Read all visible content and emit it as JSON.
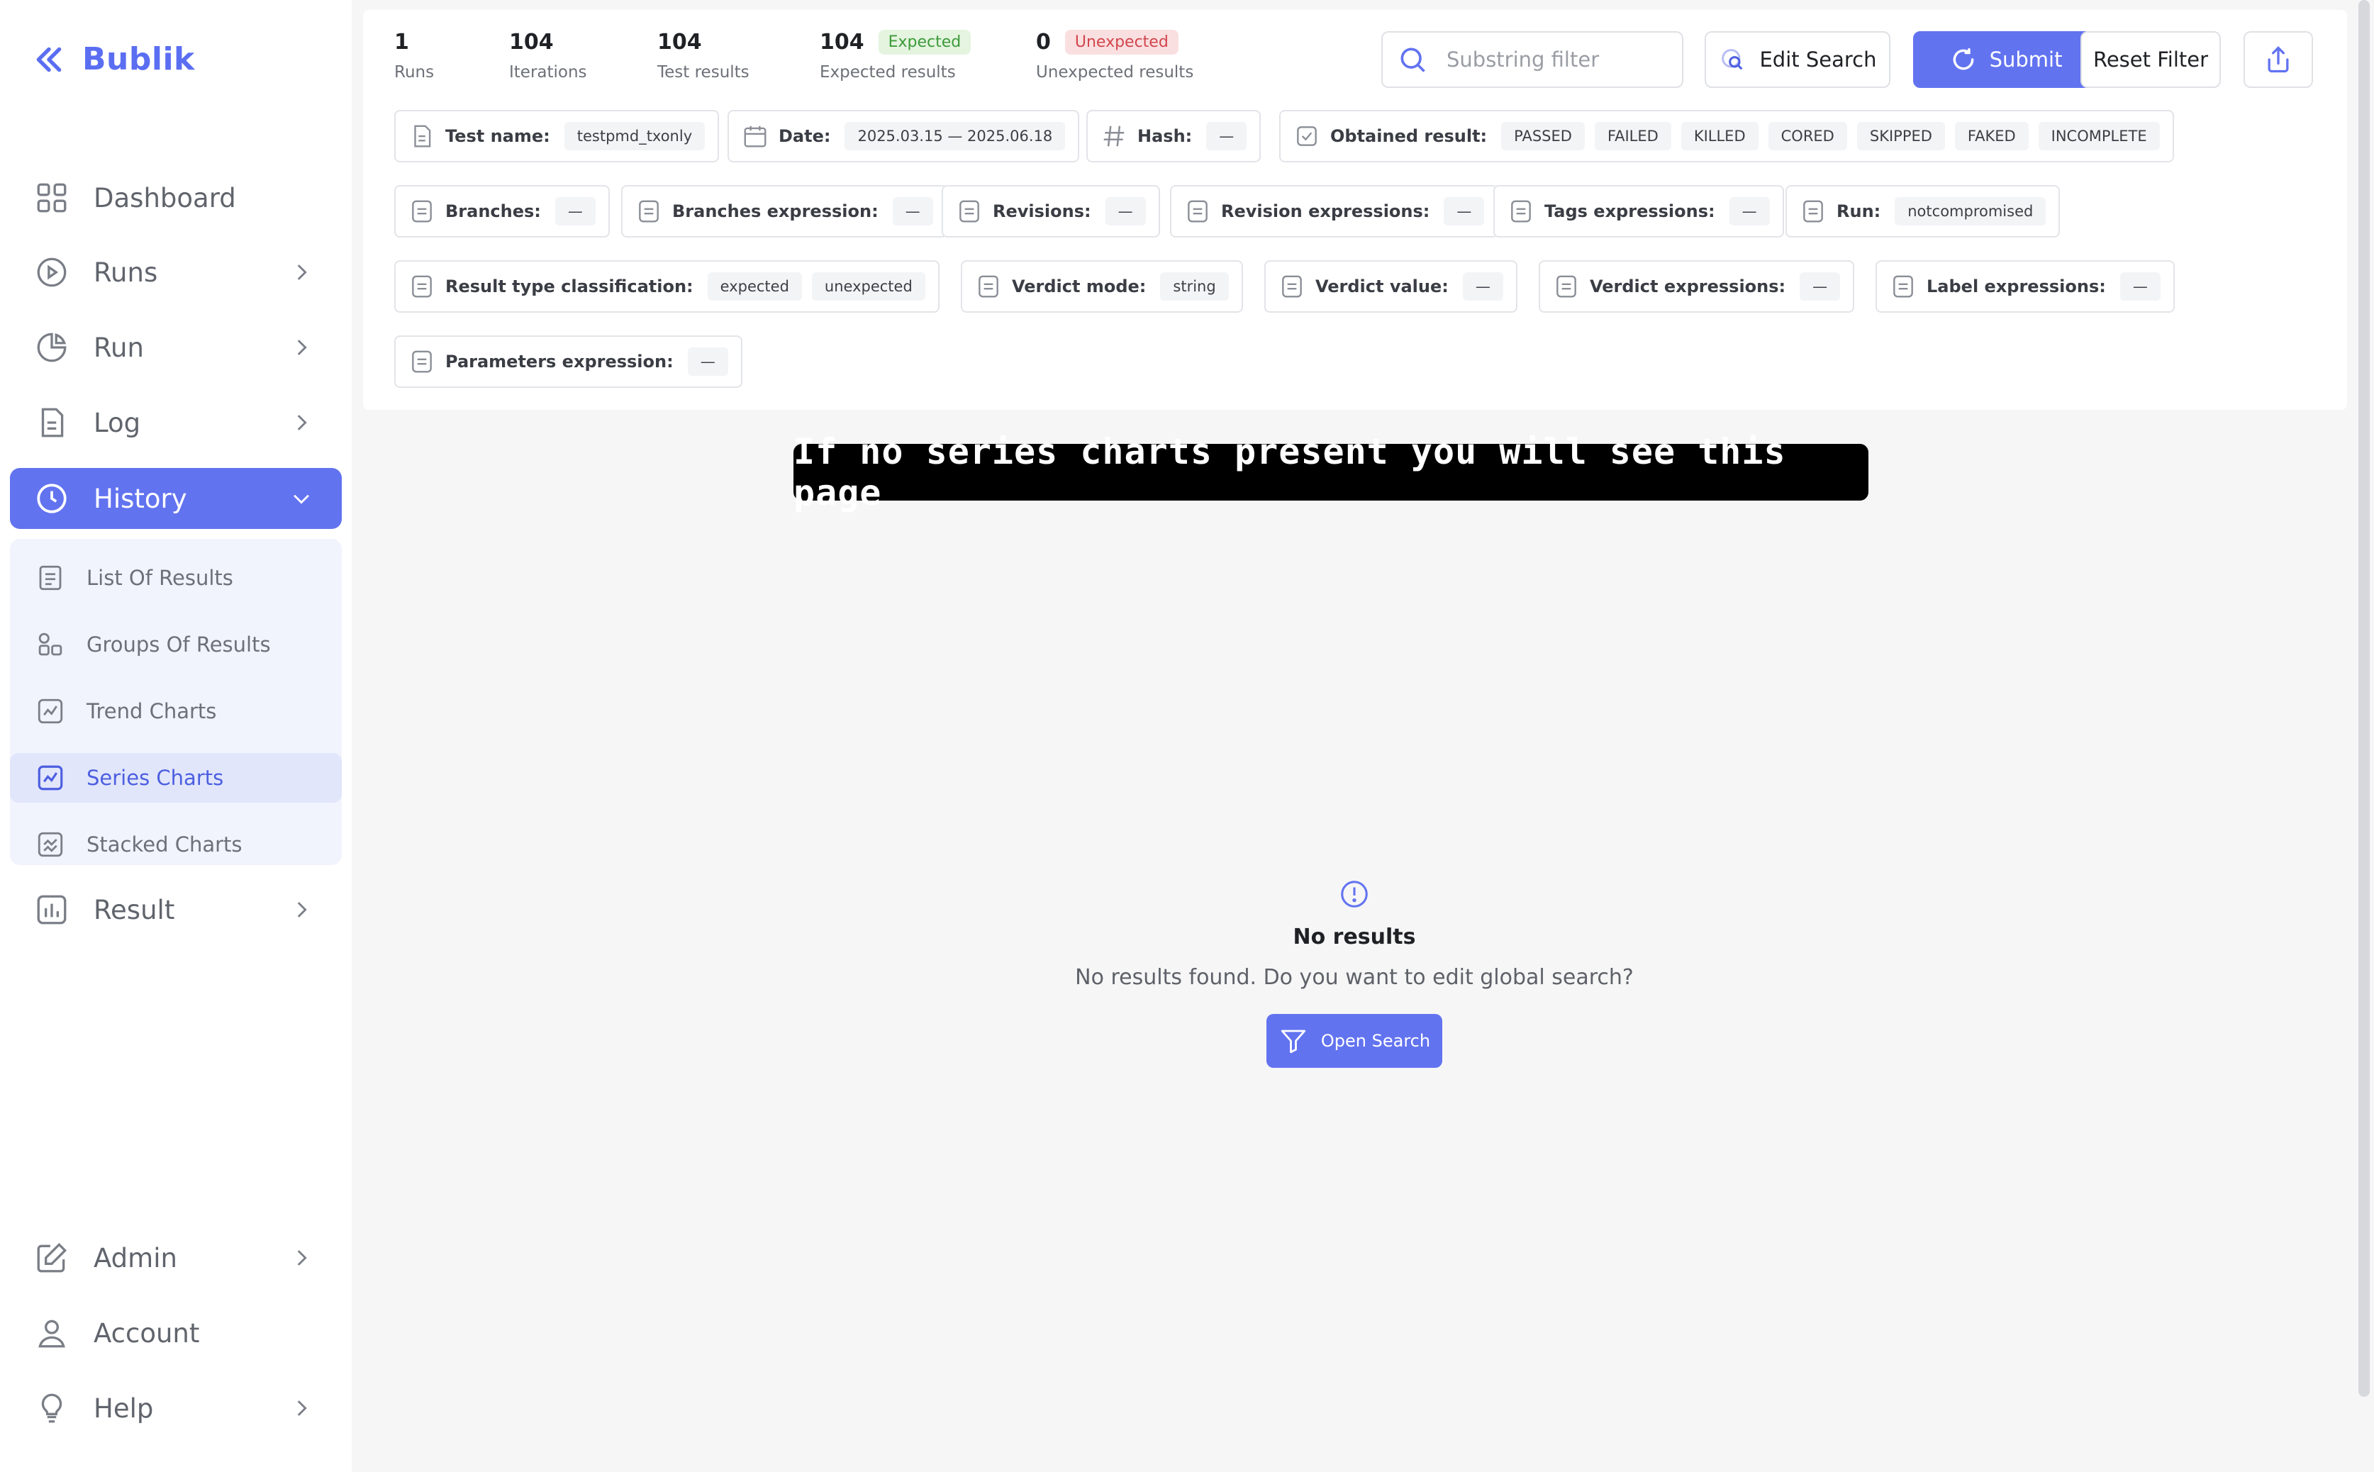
{
  "app": {
    "name": "Bublik"
  },
  "sidebar": {
    "items": [
      {
        "label": "Dashboard",
        "icon": "dashboard-icon"
      },
      {
        "label": "Runs",
        "icon": "play-circle-icon"
      },
      {
        "label": "Run",
        "icon": "pie-icon"
      },
      {
        "label": "Log",
        "icon": "log-icon"
      },
      {
        "label": "History",
        "icon": "clock-icon"
      },
      {
        "label": "Result",
        "icon": "bar-chart-icon"
      },
      {
        "label": "Admin",
        "icon": "edit-icon"
      },
      {
        "label": "Account",
        "icon": "user-icon"
      },
      {
        "label": "Help",
        "icon": "lightbulb-icon"
      }
    ],
    "history_sub": [
      {
        "label": "List Of Results"
      },
      {
        "label": "Groups Of Results"
      },
      {
        "label": "Trend Charts"
      },
      {
        "label": "Series Charts"
      },
      {
        "label": "Stacked Charts"
      }
    ]
  },
  "stats": {
    "runs": {
      "value": "1",
      "label": "Runs"
    },
    "iterations": {
      "value": "104",
      "label": "Iterations"
    },
    "test_results": {
      "value": "104",
      "label": "Test results"
    },
    "expected": {
      "value": "104",
      "badge": "Expected",
      "label": "Expected results"
    },
    "unexpected": {
      "value": "0",
      "badge": "Unexpected",
      "label": "Unexpected results"
    }
  },
  "toolbar": {
    "search_placeholder": "Substring filter",
    "edit_search": "Edit Search",
    "submit": "Submit",
    "reset_filter": "Reset Filter"
  },
  "filters": {
    "test_name": {
      "key": "Test name:",
      "value": "testpmd_txonly"
    },
    "date": {
      "key": "Date:",
      "value": "2025.03.15 — 2025.06.18"
    },
    "hash": {
      "key": "Hash:",
      "value": "—"
    },
    "obtained": {
      "key": "Obtained result:",
      "values": [
        "PASSED",
        "FAILED",
        "KILLED",
        "CORED",
        "SKIPPED",
        "FAKED",
        "INCOMPLETE"
      ]
    },
    "branches": {
      "key": "Branches:",
      "value": "—"
    },
    "branches_expr": {
      "key": "Branches expression:",
      "value": "—"
    },
    "revisions": {
      "key": "Revisions:",
      "value": "—"
    },
    "revision_expr": {
      "key": "Revision expressions:",
      "value": "—"
    },
    "tags_expr": {
      "key": "Tags expressions:",
      "value": "—"
    },
    "run": {
      "key": "Run:",
      "value": "notcompromised"
    },
    "result_type": {
      "key": "Result type classification:",
      "values": [
        "expected",
        "unexpected"
      ]
    },
    "verdict_mode": {
      "key": "Verdict mode:",
      "value": "string"
    },
    "verdict_value": {
      "key": "Verdict value:",
      "value": "—"
    },
    "verdict_expr": {
      "key": "Verdict expressions:",
      "value": "—"
    },
    "label_expr": {
      "key": "Label expressions:",
      "value": "—"
    },
    "params_expr": {
      "key": "Parameters expression:",
      "value": "—"
    }
  },
  "banner": "If no series charts present you will see this page",
  "empty": {
    "title": "No results",
    "description": "No results found. Do you want to edit global search?",
    "button": "Open Search"
  },
  "colors": {
    "accent": "#6273f0",
    "expected": "#3d9a3a",
    "unexpected": "#d2454d"
  }
}
